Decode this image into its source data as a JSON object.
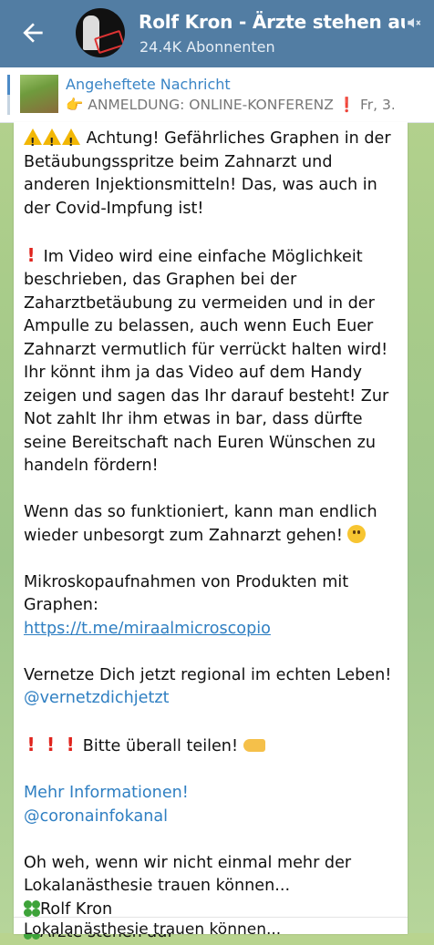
{
  "header": {
    "title": "Rolf Kron - Ärzte stehen auf",
    "subscribers": "24.4K Abonnenten"
  },
  "pinned": {
    "label": "Angeheftete Nachricht",
    "text": "👉 ANMELDUNG: ONLINE-KONFERENZ ❗ Fr, 3..."
  },
  "message": {
    "p1": "Achtung! Gefährliches Graphen in der Betäubungsspritze beim Zahnarzt und anderen Injektionsmitteln! Das, was auch in der Covid-Impfung ist!",
    "p2": "Im Video wird eine einfache Möglichkeit beschrieben, das Graphen bei der Zaharztbetäubung zu vermeiden und in der Ampulle zu belassen, auch wenn Euch Euer Zahnarzt vermutlich für verrückt halten wird! Ihr könnt ihm ja das Video auf dem Handy zeigen und sagen das Ihr darauf besteht! Zur Not zahlt Ihr ihm etwas in bar, dass dürfte seine Bereitschaft nach Euren Wünschen zu handeln fördern!",
    "p3": "Wenn das so funktioniert, kann man endlich wieder unbesorgt zum Zahnarzt gehen!",
    "p4": "Mikroskopaufnahmen von Produkten mit Graphen:",
    "link1": "https://t.me/miraalmicroscopio",
    "p5": "Vernetze Dich jetzt regional im echten Leben!",
    "mention1": "@vernetzdichjetzt",
    "share": "Bitte überall teilen!",
    "more_info": "Mehr Informationen!",
    "mention2": "@coronainfokanal",
    "p6": "Oh weh, wenn wir nicht einmal mehr der Lokalanästhesie trauen können...",
    "sig1": "Rolf Kron",
    "sig2": "Ärzte stehen auf"
  },
  "next_preview": "Lokalanästhesie trauen können...",
  "colors": {
    "header_bg": "#527da3",
    "link": "#2f7fc2",
    "pinned_label": "#3a85c6",
    "chat_bg": "#a9cc8a"
  },
  "icons": [
    "back-arrow-icon",
    "muted-speaker-icon",
    "warning-icon",
    "exclamation-icon",
    "smiling-emoji-icon",
    "pointing-hand-icon",
    "clover-icon"
  ]
}
